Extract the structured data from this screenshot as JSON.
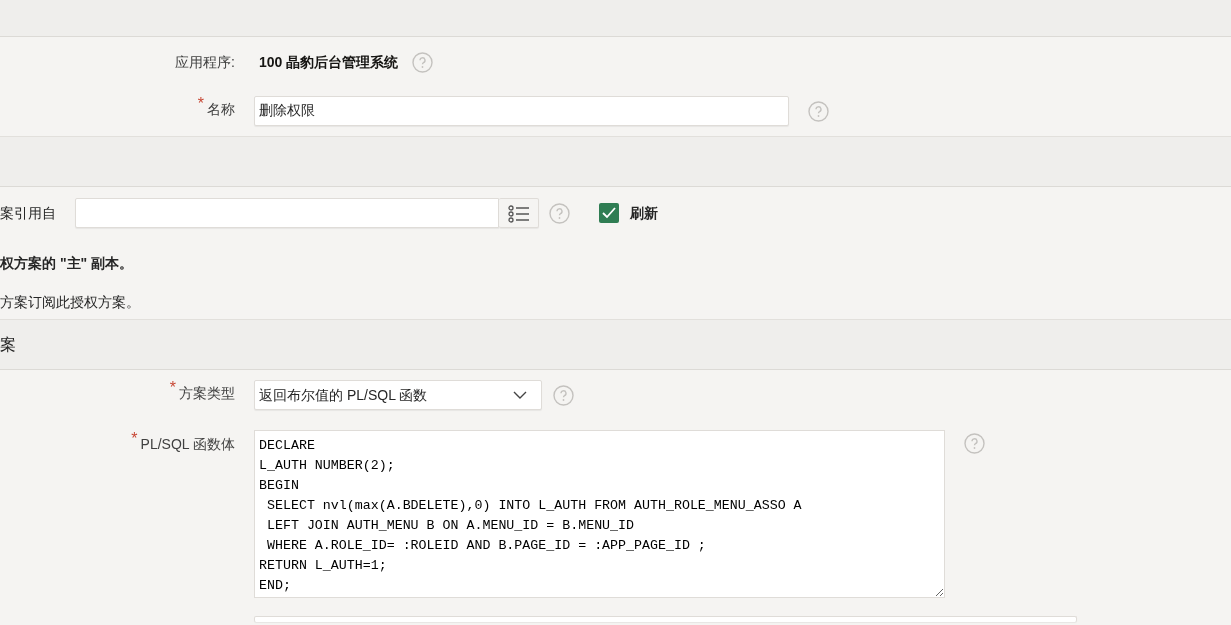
{
  "application": {
    "label": "应用程序:",
    "value": "100 晶豹后台管理系统"
  },
  "name": {
    "label": "名称",
    "required_mark": "*",
    "value": "删除权限"
  },
  "subscription": {
    "label": "案引用自",
    "checkbox": {
      "label": "刷新",
      "checked": true
    }
  },
  "notes": [
    {
      "text": "权方案的 \"主\" 副本。",
      "bold": true
    },
    {
      "text": "方案订阅此授权方案。",
      "bold": false
    }
  ],
  "section_title": "案",
  "scheme_type": {
    "label": "方案类型",
    "required_mark": "*",
    "value": "返回布尔值的 PL/SQL 函数"
  },
  "function_body": {
    "label": "PL/SQL 函数体",
    "required_mark": "*",
    "lines": [
      "DECLARE",
      "L_AUTH NUMBER(2);",
      "BEGIN",
      " SELECT nvl(max(A.BDELETE),0) INTO L_AUTH FROM AUTH_ROLE_MENU_ASSO A",
      " LEFT JOIN AUTH_MENU B ON A.MENU_ID = B.MENU_ID",
      " WHERE A.ROLE_ID= :ROLEID AND B.PAGE_ID = :APP_PAGE_ID ;",
      "RETURN L_AUTH=1;",
      "END;"
    ]
  }
}
